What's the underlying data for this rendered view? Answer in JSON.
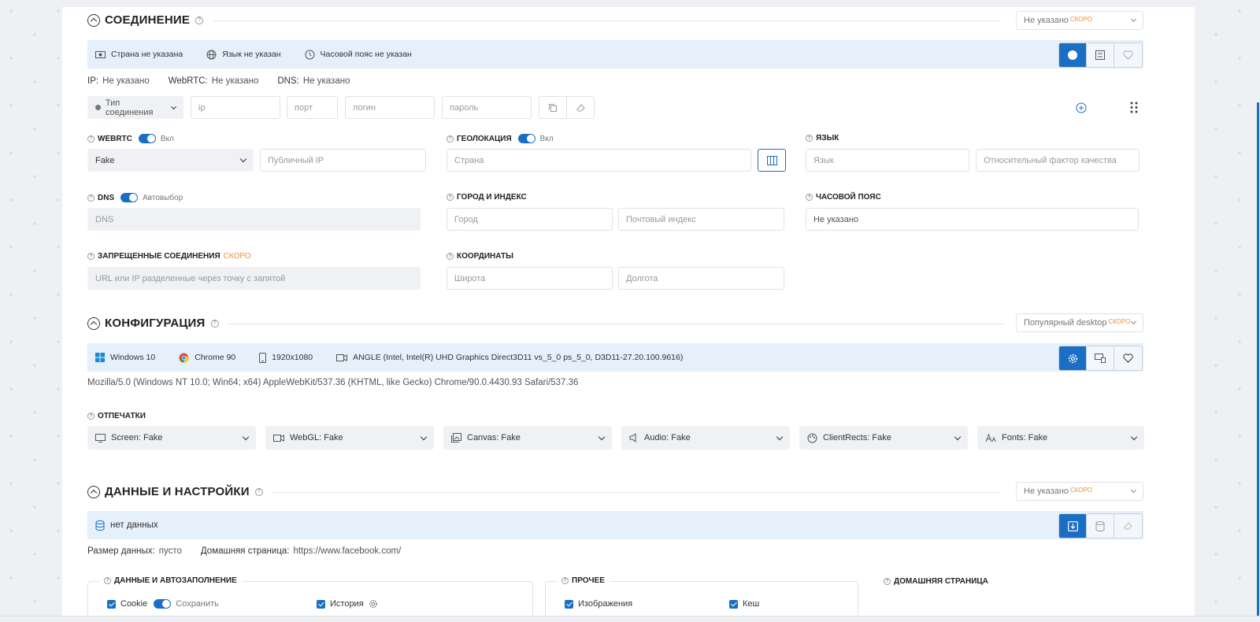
{
  "connection": {
    "title": "СОЕДИНЕНИЕ",
    "preset": "Не указано",
    "soon": "СКОРО",
    "country": "Страна не указана",
    "language": "Язык не указан",
    "timezone": "Часовой пояс не указан",
    "ip_label": "IP:",
    "ip_value": "Не указано",
    "webrtc_label": "WebRTC:",
    "webrtc_value": "Не указано",
    "dns_label": "DNS:",
    "dns_value": "Не указано",
    "proxy_type": "Тип соединения",
    "ip_placeholder": "ip",
    "port_placeholder": "порт",
    "login_placeholder": "логин",
    "password_placeholder": "пароль"
  },
  "webrtc": {
    "label": "WEBRTC",
    "toggle_label": "Вкл",
    "mode": "Fake",
    "public_ip_placeholder": "Публичный IP"
  },
  "geolocation": {
    "label": "ГЕОЛОКАЦИЯ",
    "toggle_label": "Вкл",
    "country_placeholder": "Страна"
  },
  "language": {
    "label": "ЯЗЫК",
    "language_placeholder": "Язык",
    "quality_placeholder": "Относительный фактор качества"
  },
  "dns": {
    "label": "DNS",
    "toggle_label": "Автовыбор",
    "placeholder": "DNS"
  },
  "city": {
    "label": "ГОРОД И ИНДЕКС",
    "city_placeholder": "Город",
    "zip_placeholder": "Почтовый индекс"
  },
  "timezone": {
    "label": "ЧАСОВОЙ ПОЯС",
    "value": "Не указано"
  },
  "blocked": {
    "label": "ЗАПРЕЩЕННЫЕ СОЕДИНЕНИЯ",
    "soon": "СКОРО",
    "placeholder": "URL или IP разделенные через точку с запятой"
  },
  "coords": {
    "label": "КООРДИНАТЫ",
    "lat_placeholder": "Широта",
    "lon_placeholder": "Долгота"
  },
  "config": {
    "title": "КОНФИГУРАЦИЯ",
    "preset": "Популярный desktop",
    "soon": "СКОРО",
    "os": "Windows 10",
    "browser": "Chrome 90",
    "resolution": "1920x1080",
    "gpu": "ANGLE (Intel, Intel(R) UHD Graphics Direct3D11 vs_5_0 ps_5_0, D3D11-27.20.100.9616)",
    "user_agent": "Mozilla/5.0 (Windows NT 10.0; Win64; x64) AppleWebKit/537.36 (KHTML, like Gecko) Chrome/90.0.4430.93 Safari/537.36"
  },
  "fingerprints": {
    "label": "ОТПЕЧАТКИ",
    "items": [
      "Screen: Fake",
      "WebGL: Fake",
      "Canvas: Fake",
      "Audio: Fake",
      "ClientRects: Fake",
      "Fonts: Fake"
    ]
  },
  "data": {
    "title": "ДАННЫЕ И НАСТРОЙКИ",
    "preset": "Не указано",
    "soon": "СКОРО",
    "status": "нет данных",
    "size_label": "Размер данных:",
    "size_value": "пусто",
    "homepage_label": "Домашняя страница:",
    "homepage_value": "https://www.facebook.com/",
    "autofill_legend": "ДАННЫЕ И АВТОЗАПОЛНЕНИЕ",
    "cookie": "Cookie",
    "save": "Сохранить",
    "history": "История",
    "other_legend": "ПРОЧЕЕ",
    "images": "Изображения",
    "cache": "Кеш",
    "homepage_section": "ДОМАШНЯЯ СТРАНИЦА"
  },
  "colors": {
    "accent": "#1a6fc4",
    "soon": "#f0903a",
    "bar": "#e5f0fb"
  }
}
